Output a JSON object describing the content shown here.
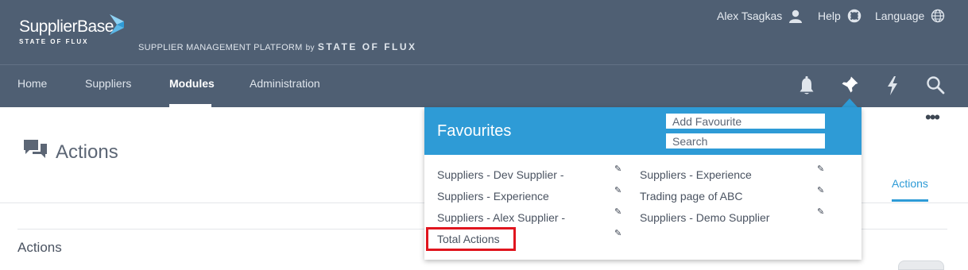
{
  "header": {
    "logo": {
      "name": "SupplierBase",
      "subtitle": "STATE OF FLUX"
    },
    "platform": {
      "text": "SUPPLIER MANAGEMENT PLATFORM",
      "by": "by",
      "brand": "STATE OF FLUX"
    },
    "user_menu": [
      {
        "label": "Alex Tsagkas",
        "icon": "user-icon"
      },
      {
        "label": "Help",
        "icon": "lifebuoy-icon"
      },
      {
        "label": "Language",
        "icon": "globe-icon"
      }
    ],
    "nav": [
      "Home",
      "Suppliers",
      "Modules",
      "Administration"
    ],
    "active_nav": "Modules",
    "nav_icons": [
      "bell-icon",
      "pin-icon",
      "lightning-icon",
      "search-icon"
    ]
  },
  "page": {
    "title": "Actions",
    "title_icon": "chat-bubbles-icon",
    "more_icon": "more-dots-icon",
    "tab_label": "Actions",
    "section_title": "Actions"
  },
  "favourites": {
    "title": "Favourites",
    "add_placeholder": "Add Favourite",
    "search_placeholder": "Search",
    "left_items": [
      "Suppliers - Dev Supplier -",
      "Suppliers - Experience",
      "Suppliers - Alex Supplier -",
      "Total Actions"
    ],
    "right_items": [
      "Suppliers - Experience",
      "Trading page of ABC",
      "Suppliers - Demo Supplier"
    ],
    "edit_icon": "pencil-icon",
    "highlighted_item": "Total Actions"
  },
  "colors": {
    "header_bg": "#4f5f73",
    "accent": "#2e9bd6",
    "highlight": "#e0151e"
  }
}
